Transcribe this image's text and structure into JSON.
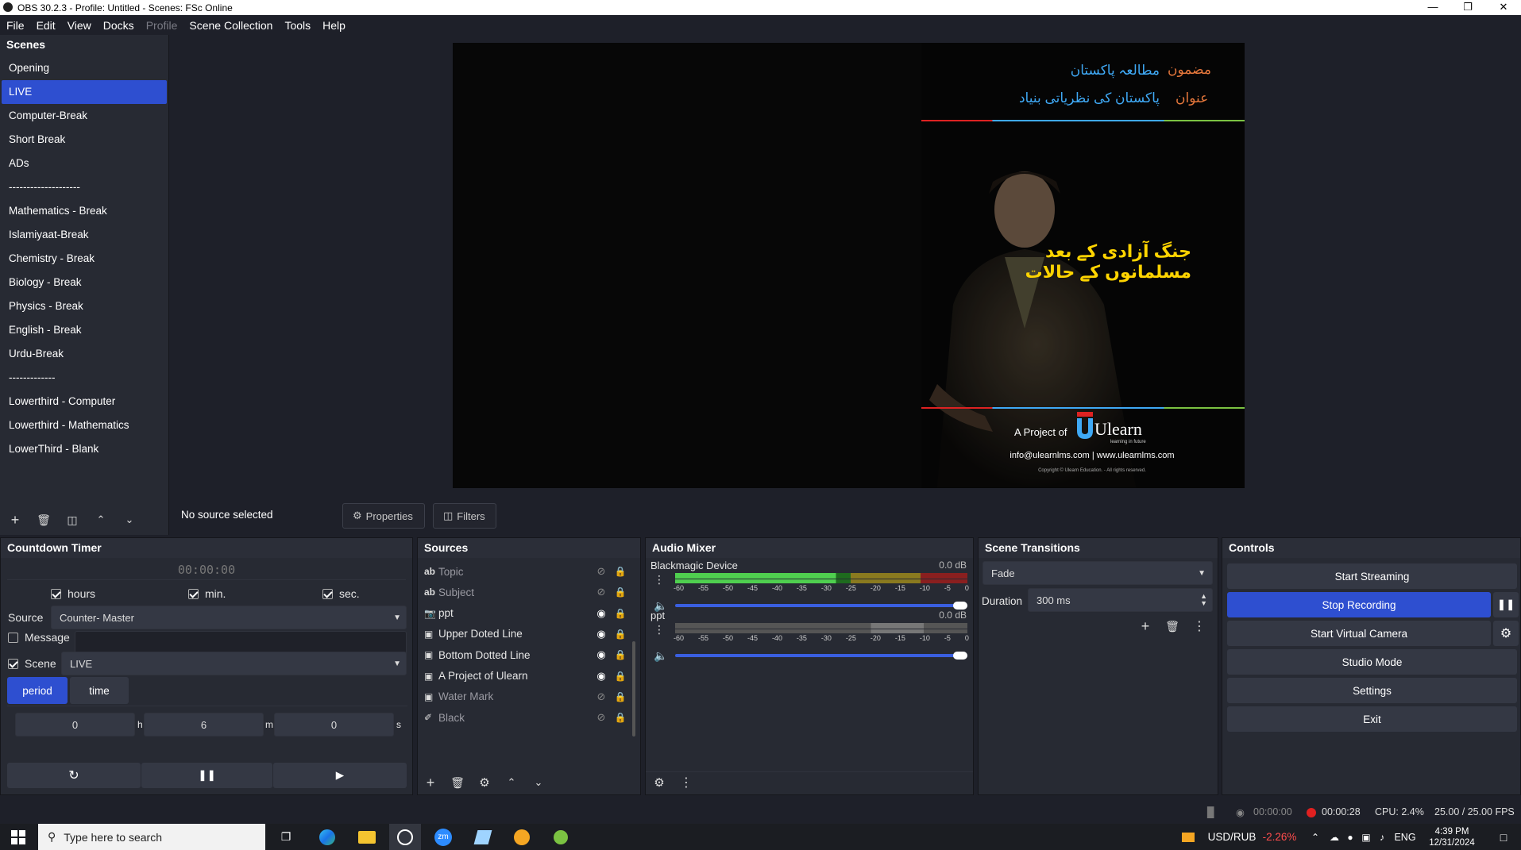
{
  "window": {
    "title": "OBS 30.2.3 - Profile: Untitled - Scenes: FSc Online"
  },
  "menu": [
    {
      "label": "File",
      "enabled": true
    },
    {
      "label": "Edit",
      "enabled": true
    },
    {
      "label": "View",
      "enabled": true
    },
    {
      "label": "Docks",
      "enabled": true
    },
    {
      "label": "Profile",
      "enabled": false
    },
    {
      "label": "Scene Collection",
      "enabled": true
    },
    {
      "label": "Tools",
      "enabled": true
    },
    {
      "label": "Help",
      "enabled": true
    }
  ],
  "scenes": {
    "title": "Scenes",
    "items": [
      "Opening",
      "LIVE",
      "Computer-Break",
      "Short Break",
      "ADs",
      "--------------------",
      "Mathematics  - Break",
      "Islamiyaat-Break",
      "Chemistry  - Break",
      "Biology  - Break",
      "Physics  - Break",
      "English - Break",
      "Urdu-Break",
      "-------------",
      "Lowerthird - Computer",
      "Lowerthird - Mathematics",
      "LowerThird - Blank"
    ],
    "selected": "LIVE"
  },
  "preview": {
    "subject_label": "مضمون",
    "subject_value": "مطالعہ پاکستان",
    "topic_label": "عنوان",
    "topic_value": "پاکستان کی نظریاتی بنیاد",
    "ppt_text": "جنگ آزادی کے بعد مسلمانوں کے حالات",
    "project_of": "A Project of",
    "brand": "Ulearn",
    "brand_tagline": "learning in future",
    "contact": "info@ulearnlms.com | www.ulearnlms.com",
    "copyright": "Copyright © Ulearn Education. - All rights reserved."
  },
  "source_bar": {
    "status": "No source selected",
    "properties": "Properties",
    "filters": "Filters"
  },
  "countdown": {
    "title": "Countdown Timer",
    "display": "00:00:00",
    "hours_label": "hours",
    "min_label": "min.",
    "sec_label": "sec.",
    "source_label": "Source",
    "source_value": "Counter- Master",
    "message_label": "Message",
    "scene_label": "Scene",
    "scene_value": "LIVE",
    "tab_period": "period",
    "tab_time": "time",
    "h_value": "0",
    "h_unit": "h",
    "m_value": "6",
    "m_unit": "m",
    "s_value": "0",
    "s_unit": "s"
  },
  "sources": {
    "title": "Sources",
    "items": [
      {
        "icon": "text-icon",
        "name": "Topic",
        "visible": false
      },
      {
        "icon": "text-icon",
        "name": "Subject",
        "visible": false
      },
      {
        "icon": "camera-icon",
        "name": "ppt",
        "visible": true
      },
      {
        "icon": "image-icon",
        "name": "Upper Doted Line",
        "visible": true
      },
      {
        "icon": "image-icon",
        "name": "Bottom Dotted Line",
        "visible": true
      },
      {
        "icon": "image-icon",
        "name": "A Project of Ulearn",
        "visible": true
      },
      {
        "icon": "image-icon",
        "name": "Water Mark",
        "visible": false
      },
      {
        "icon": "brush-icon",
        "name": "Black",
        "visible": false
      }
    ]
  },
  "audio": {
    "title": "Audio Mixer",
    "channels": [
      {
        "name": "Blackmagic Device",
        "db": "0.0 dB",
        "muted": false,
        "level": 0.55
      },
      {
        "name": "ppt",
        "db": "0.0 dB",
        "muted": true,
        "level": 0
      }
    ],
    "ticks": [
      "-60",
      "-55",
      "-50",
      "-45",
      "-40",
      "-35",
      "-30",
      "-25",
      "-20",
      "-15",
      "-10",
      "-5",
      "0"
    ]
  },
  "transitions": {
    "title": "Scene Transitions",
    "type": "Fade",
    "duration_label": "Duration",
    "duration_value": "300 ms"
  },
  "controls": {
    "title": "Controls",
    "start_streaming": "Start Streaming",
    "stop_recording": "Stop Recording",
    "start_virtual_camera": "Start Virtual Camera",
    "studio_mode": "Studio Mode",
    "settings": "Settings",
    "exit": "Exit"
  },
  "status": {
    "stream_time": "00:00:00",
    "rec_time": "00:00:28",
    "cpu": "CPU: 2.4%",
    "fps": "25.00 / 25.00 FPS"
  },
  "taskbar": {
    "search_placeholder": "Type here to search",
    "ticker_symbol": "USD/RUB",
    "ticker_change": "-2.26%",
    "lang": "ENG",
    "time": "4:39 PM",
    "date": "12/31/2024",
    "zoom_label": "zm"
  },
  "colors": {
    "accent": "#2e4fd0",
    "ticker_negative": "#ff4d4d",
    "urdu_title": "#3fa9f5",
    "urdu_label": "#e7783c",
    "ppt_text": "#ffd400"
  }
}
